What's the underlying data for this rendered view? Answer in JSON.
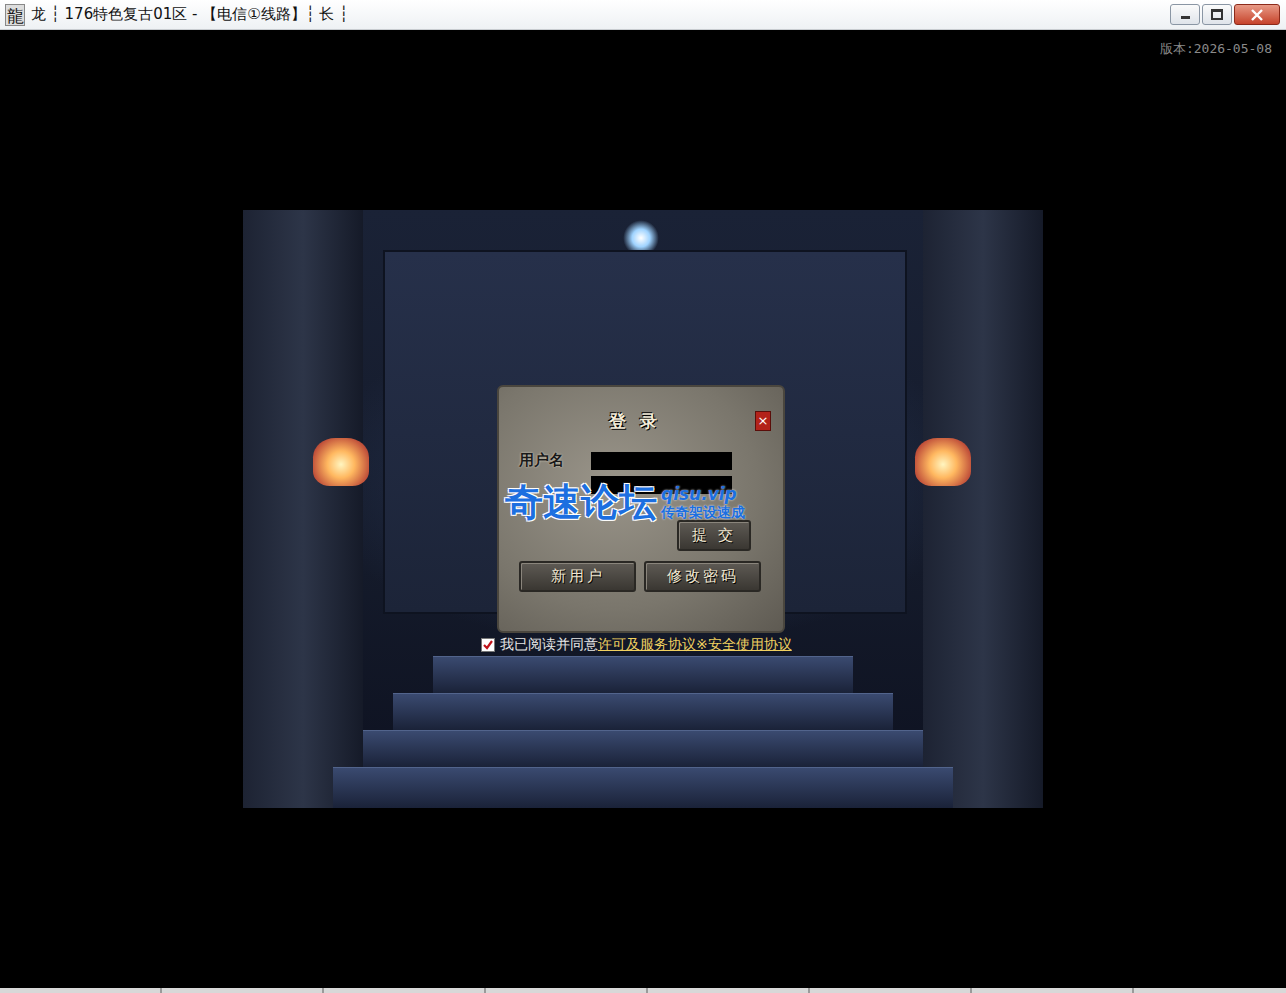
{
  "window": {
    "icon": "龍",
    "title": "龙 ┆ 176特色复古01区 - 【电信①线路】┆ 长 ┆"
  },
  "version": "版本:2026-05-08",
  "login": {
    "title": "登 录",
    "close": "×",
    "username_label": "用户名",
    "buttons": [
      {
        "label": "提 交"
      },
      {
        "label": "新用户"
      },
      {
        "label": "修改密码"
      }
    ],
    "agreement": {
      "checked": true,
      "text": "我已阅读并同意",
      "link": "许可及服务协议※安全使用协议"
    }
  },
  "watermark": {
    "brand": "奇速论坛",
    "url": "qisu.vip",
    "slogan": "传奇架设速成"
  }
}
